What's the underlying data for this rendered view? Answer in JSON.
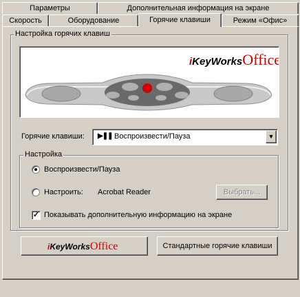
{
  "tabs": {
    "row1": [
      "Параметры",
      "Дополнительная информация на экране"
    ],
    "row2": [
      "Скорость",
      "Оборудование",
      "Горячие клавиши",
      "Режим «Офис»"
    ]
  },
  "hotkeys_group": {
    "title": "Настройка горячих клавиш",
    "logo": {
      "prefix": "i",
      "mid": "KeyWorks",
      "suffix": "Office",
      "accent": "#cc0000"
    },
    "hotkey_label": "Горячие клавиши:",
    "hotkey_value": "Воспроизвести/Пауза",
    "hotkey_icon": "play-pause-icon"
  },
  "settings_group": {
    "title": "Настройка",
    "option_default": "Воспроизвести/Пауза",
    "option_custom": "Настроить:",
    "custom_app": "Acrobat Reader",
    "choose_button": "Выбрать...",
    "osd_checkbox": "Показывать дополнительную информацию на экране",
    "selected_option": "default",
    "osd_checked": true
  },
  "footer": {
    "logo_button": {
      "prefix": "i",
      "mid": "KeyWorks",
      "suffix": "Office"
    },
    "default_hotkeys_button": "Стандартные горячие клавиши"
  }
}
